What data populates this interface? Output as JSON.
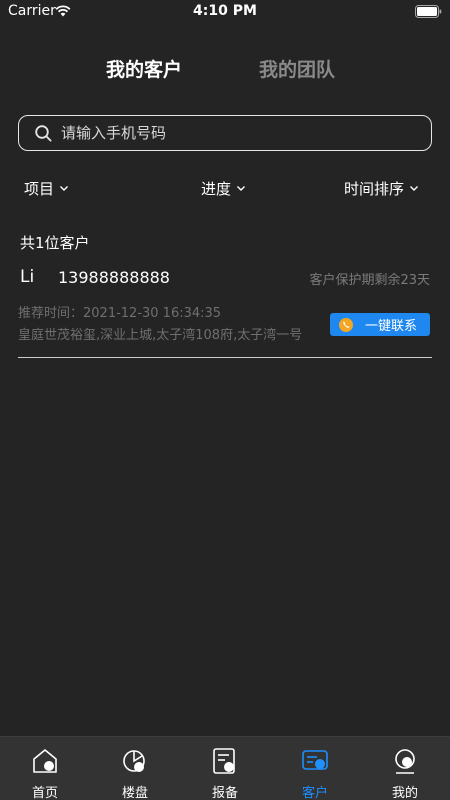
{
  "status": {
    "carrier": "Carrier",
    "time": "4:10 PM"
  },
  "tabs": {
    "active": "我的客户",
    "inactive": "我的团队"
  },
  "search": {
    "placeholder": "请输入手机号码"
  },
  "filters": {
    "project": "项目",
    "progress": "进度",
    "sort": "时间排序"
  },
  "list": {
    "count_label": "共1位客户",
    "items": [
      {
        "name": "Li",
        "phone": "13988888888",
        "protect": "客户保护期剩余23天",
        "recommend_time": "推荐时间：2021-12-30 16:34:35",
        "projects": "皇庭世茂裕玺,深业上城,太子湾108府,太子湾一号",
        "contact_label": "一键联系"
      }
    ]
  },
  "tabbar": {
    "items": [
      {
        "label": "首页",
        "icon": "home-icon"
      },
      {
        "label": "楼盘",
        "icon": "building-icon"
      },
      {
        "label": "报备",
        "icon": "report-icon"
      },
      {
        "label": "客户",
        "icon": "customer-icon"
      },
      {
        "label": "我的",
        "icon": "profile-icon"
      }
    ],
    "active_index": 3
  },
  "colors": {
    "background": "#242424",
    "accent": "#1e88f0",
    "muted": "#6f6f6f",
    "phone_icon": "#f5a623"
  }
}
